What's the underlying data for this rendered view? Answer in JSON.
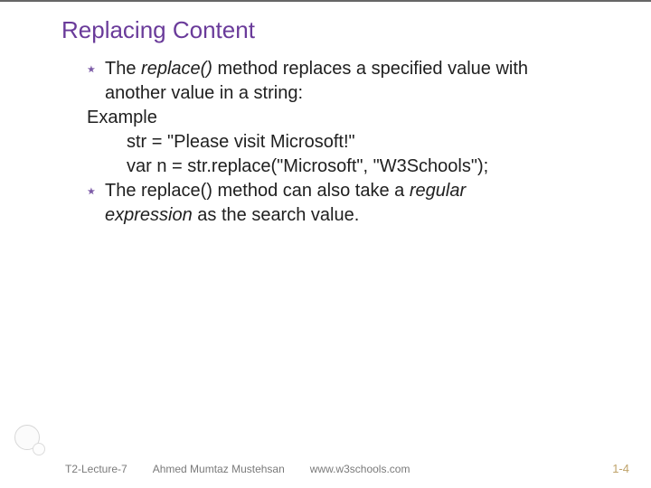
{
  "title": "Replacing Content",
  "bullets": {
    "b1_pre": "The ",
    "b1_em": "replace()",
    "b1_post": " method replaces a specified value with",
    "b1_cont": "another value in a string:",
    "example_label": "Example",
    "code1": "str = \"Please visit Microsoft!\"",
    "code2": "var n = str.replace(\"Microsoft\", \"W3Schools\");",
    "b2_pre": "The replace() method can also take a ",
    "b2_em1": "regular",
    "b2_em2": "expression",
    "b2_post": " as the search value."
  },
  "footer": {
    "left": "T2-Lecture-7",
    "mid": "Ahmed Mumtaz Mustehsan",
    "right": "www.w3schools.com",
    "page": "1-4"
  },
  "marker": "٭"
}
